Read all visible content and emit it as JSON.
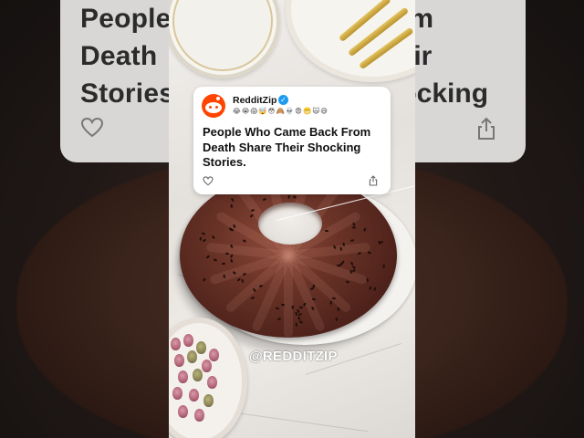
{
  "post": {
    "account_name": "RedditZip",
    "verified_icon": "check-badge-icon",
    "emoji_line": "😂😭😱🤯😳🙈💀😨😬🙀😅",
    "title": "People Who Came Back From Death Share Their Shocking Stories.",
    "like_icon": "heart-outline-icon",
    "share_icon": "share-icon"
  },
  "background_card": {
    "title_visible": "People\nDeath\nStories",
    "title_right_fragments": "From\nTheir Shocking"
  },
  "watermark": {
    "text": "@REDDITZIP"
  },
  "colors": {
    "avatar_brand": "#ff4500",
    "verified_badge": "#1d9bf0",
    "card_background": "#ffffff",
    "cake_chocolate": "#5a2a20"
  }
}
